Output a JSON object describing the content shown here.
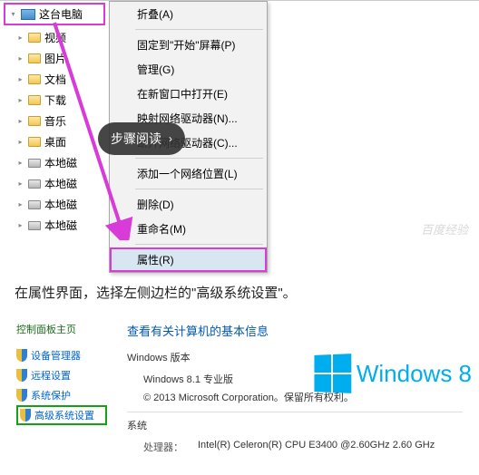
{
  "tree": {
    "root": "这台电脑",
    "items": [
      {
        "label": "视频",
        "icon": "folder"
      },
      {
        "label": "图片",
        "icon": "folder"
      },
      {
        "label": "文档",
        "icon": "folder"
      },
      {
        "label": "下载",
        "icon": "folder"
      },
      {
        "label": "音乐",
        "icon": "folder"
      },
      {
        "label": "桌面",
        "icon": "folder"
      },
      {
        "label": "本地磁",
        "icon": "drive"
      },
      {
        "label": "本地磁",
        "icon": "drive"
      },
      {
        "label": "本地磁",
        "icon": "drive"
      },
      {
        "label": "本地磁",
        "icon": "drive"
      }
    ]
  },
  "context_menu": [
    {
      "label": "折叠(A)",
      "type": "item"
    },
    {
      "type": "sep"
    },
    {
      "label": "固定到\"开始\"屏幕(P)",
      "type": "item"
    },
    {
      "label": "管理(G)",
      "type": "item"
    },
    {
      "label": "在新窗口中打开(E)",
      "type": "item"
    },
    {
      "label": "映射网络驱动器(N)...",
      "type": "item"
    },
    {
      "label": "断开网络驱动器(C)...",
      "type": "item"
    },
    {
      "type": "sep"
    },
    {
      "label": "添加一个网络位置(L)",
      "type": "item"
    },
    {
      "type": "sep"
    },
    {
      "label": "删除(D)",
      "type": "item"
    },
    {
      "label": "重命名(M)",
      "type": "item"
    },
    {
      "type": "sep"
    },
    {
      "label": "属性(R)",
      "type": "item",
      "highlighted": true
    }
  ],
  "step_badge": {
    "label": "步骤阅读",
    "chevron": "›"
  },
  "watermark": "百度经验",
  "instruction": "在属性界面，选择左侧边栏的\"高级系统设置\"。",
  "props_panel": {
    "cp_title": "控制面板主页",
    "links": [
      {
        "label": "设备管理器"
      },
      {
        "label": "远程设置"
      },
      {
        "label": "系统保护"
      },
      {
        "label": "高级系统设置",
        "highlighted": true
      }
    ],
    "heading": "查看有关计算机的基本信息",
    "section1": {
      "label": "Windows 版本",
      "edition": "Windows 8.1 专业版",
      "copyright": "© 2013 Microsoft Corporation。保留所有权利。"
    },
    "section2": {
      "label": "系统",
      "cpu_label": "处理器：",
      "cpu_value": "Intel(R) Celeron(R) CPU    E3400  @2.60GHz  2.60 GHz"
    },
    "logo_text": "Windows 8"
  }
}
